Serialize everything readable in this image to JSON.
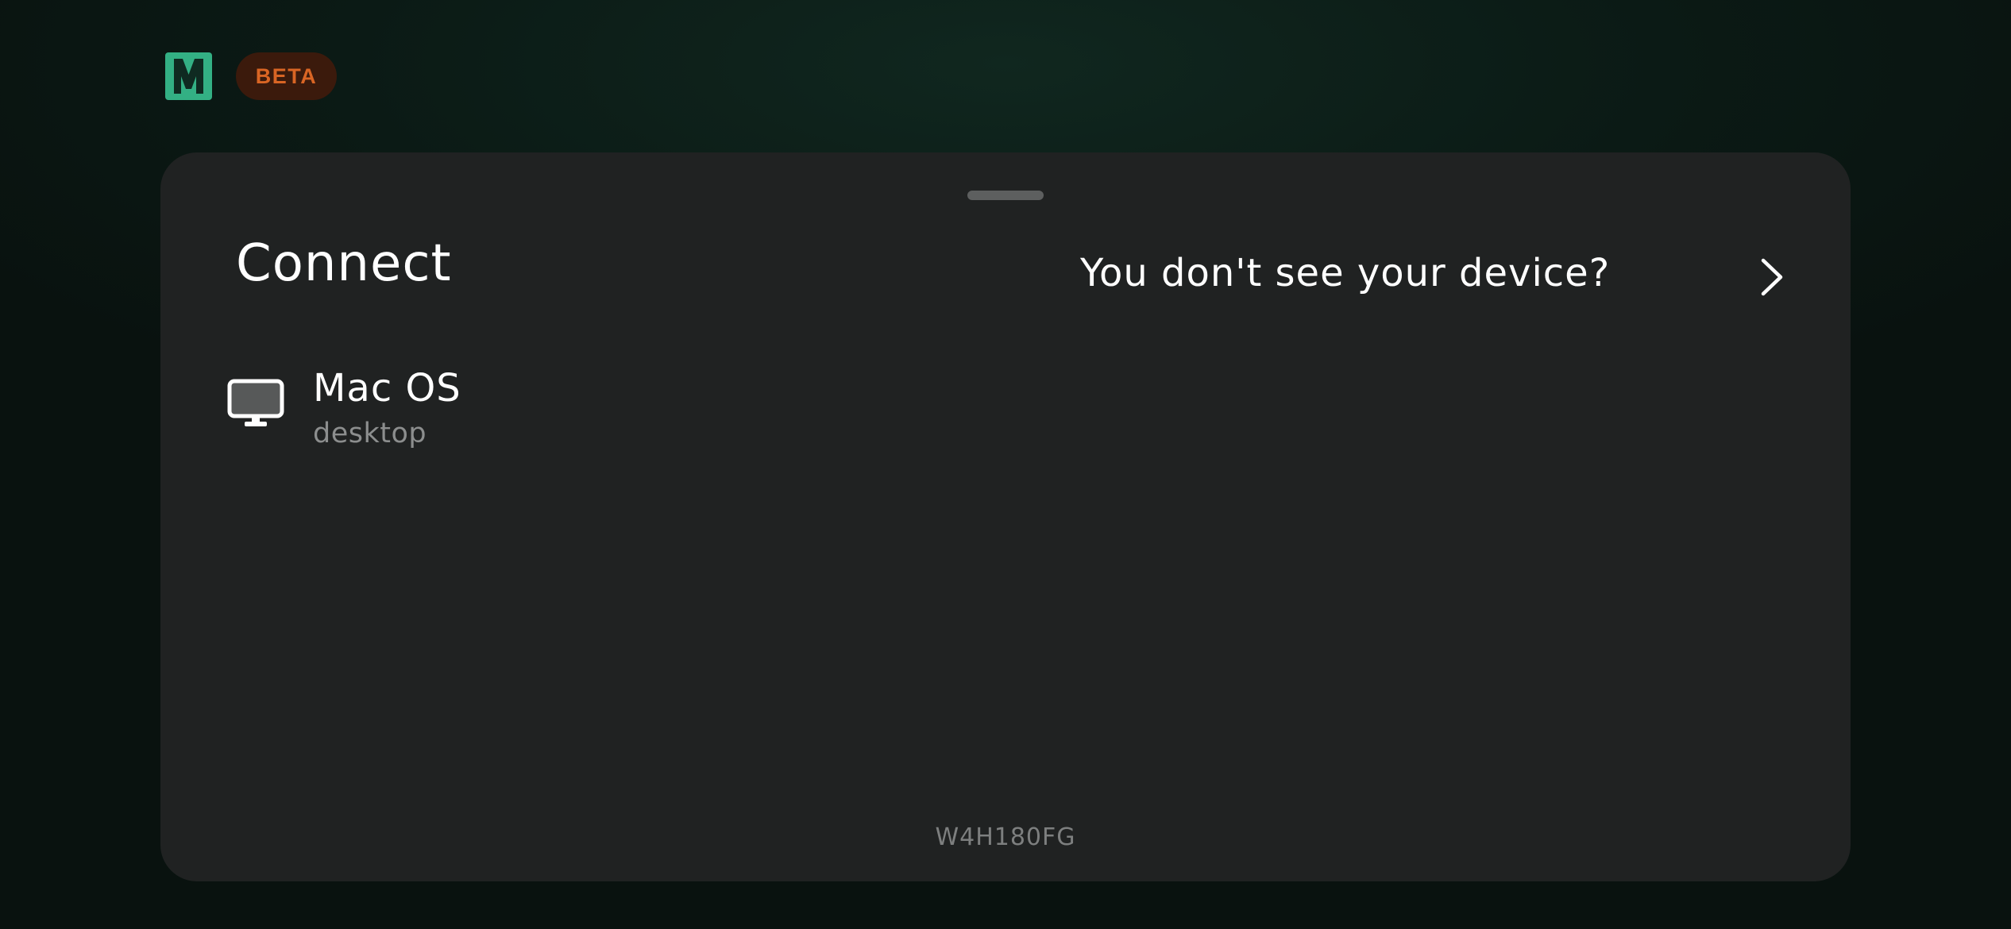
{
  "header": {
    "logo_icon": "m-logo-icon",
    "logo_color": "#33b084",
    "badge_label": "BETA",
    "badge_color": "#d96524"
  },
  "sheet": {
    "title": "Connect",
    "help_link_label": "You don't see your device?",
    "help_link_icon": "chevron-right-icon",
    "devices": [
      {
        "name": "Mac OS",
        "type": "desktop",
        "icon": "monitor-icon"
      }
    ],
    "code": "W4H180FG"
  }
}
